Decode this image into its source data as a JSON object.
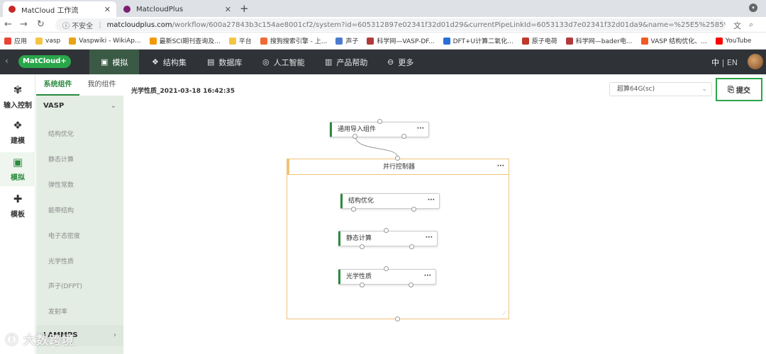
{
  "browser": {
    "tabs": [
      {
        "title": "MatCloud 工作流",
        "active": true
      },
      {
        "title": "MatcloudPlus",
        "active": false
      }
    ],
    "new_tab": "+",
    "address": {
      "security_label": "不安全",
      "host": "matcloudplus.com",
      "path": "/workflow/600a27843b3c154ae8001cf2/system?id=605312897e02341f32d01d29&currentPipeLinkId=6053133d7e02341f32d01da9&name=%25E5%2585%2589%25E5%25A..."
    },
    "bookmarks": [
      {
        "label": "应用",
        "color": "#ea4335"
      },
      {
        "label": "vasp",
        "color": "#f4c542"
      },
      {
        "label": "Vaspwiki - WikiAp...",
        "color": "#e8a317"
      },
      {
        "label": "最新SCI期刊查询及...",
        "color": "#f29900"
      },
      {
        "label": "平台",
        "color": "#f4c542"
      },
      {
        "label": "搜狗搜索引擎 - 上...",
        "color": "#f06a35"
      },
      {
        "label": "声子",
        "color": "#4a7bd0"
      },
      {
        "label": "科学网—VASP-DF...",
        "color": "#b03a3a"
      },
      {
        "label": "DFT+U计算二氧化...",
        "color": "#2a6fd6"
      },
      {
        "label": "原子电荷",
        "color": "#c0392b"
      },
      {
        "label": "科学网—bader电...",
        "color": "#b03a3a"
      },
      {
        "label": "VASP 结构优化、...",
        "color": "#f15a24"
      },
      {
        "label": "YouTube",
        "color": "#ff0000"
      }
    ]
  },
  "app": {
    "logo": "MatCloud+",
    "nav": [
      {
        "label": "模拟",
        "icon": "cube",
        "active": true
      },
      {
        "label": "结构集",
        "icon": "cubes",
        "active": false
      },
      {
        "label": "数据库",
        "icon": "table",
        "active": false
      },
      {
        "label": "人工智能",
        "icon": "brain",
        "active": false
      },
      {
        "label": "产品帮助",
        "icon": "book",
        "active": false
      },
      {
        "label": "更多",
        "icon": "circle-minus",
        "active": false
      }
    ],
    "lang_zh": "中",
    "lang_sep": "|",
    "lang_en": "EN"
  },
  "leftbar": [
    {
      "label": "输入控制",
      "icon": "flower",
      "active": false
    },
    {
      "label": "建模",
      "icon": "cubes",
      "active": false
    },
    {
      "label": "模拟",
      "icon": "cube",
      "active": true
    },
    {
      "label": "模板",
      "icon": "puzzle",
      "active": false
    }
  ],
  "panel": {
    "tabs": [
      "系统组件",
      "我的组件"
    ],
    "groups": [
      {
        "label": "VASP",
        "expanded": true
      },
      {
        "label": "LAMMPS",
        "expanded": false
      }
    ],
    "items": [
      "结构优化",
      "静态计算",
      "弹性常数",
      "能带结构",
      "电子态密度",
      "光学性质",
      "声子(DFPT)",
      "发射率"
    ]
  },
  "main": {
    "title": "光学性质_2021-03-18 16:42:35",
    "queue": "超算64G(sc)",
    "submit": "提交",
    "nodes": {
      "import": "通用导入组件",
      "parallel": "并行控制器",
      "relax": "结构优化",
      "static": "静态计算",
      "optical": "光学性质"
    },
    "more": "···"
  },
  "watermark": "大数跨境"
}
